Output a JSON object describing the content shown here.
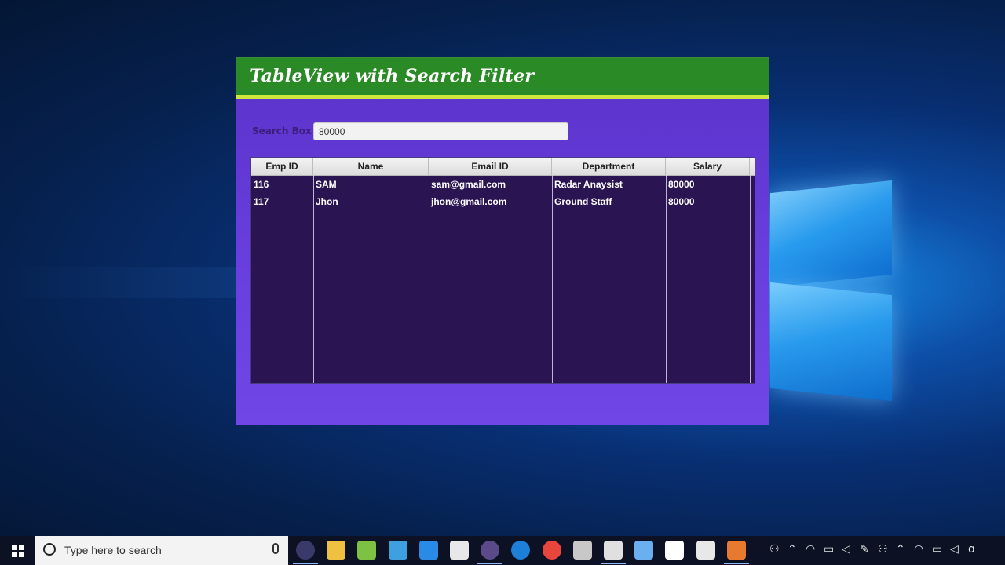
{
  "app": {
    "title": "TableView with Search Filter",
    "search_label": "Search Box",
    "search_value": "80000",
    "columns": [
      "Emp ID",
      "Name",
      "Email ID",
      "Department",
      "Salary"
    ],
    "rows": [
      {
        "emp_id": "116",
        "name": "SAM",
        "email": "sam@gmail.com",
        "department": "Radar Anaysist",
        "salary": "80000"
      },
      {
        "emp_id": "117",
        "name": "Jhon",
        "email": "jhon@gmail.com",
        "department": "Ground Staff",
        "salary": "80000"
      }
    ]
  },
  "taskbar": {
    "search_placeholder": "Type here to search",
    "icons": [
      {
        "name": "eclipse-icon",
        "color": "#3a3a6a"
      },
      {
        "name": "file-explorer-icon",
        "color": "#f0c040"
      },
      {
        "name": "notepad-plus-icon",
        "color": "#7dc242"
      },
      {
        "name": "network-icon",
        "color": "#3fa0e0"
      },
      {
        "name": "snipping-tool-icon",
        "color": "#2a8be6"
      },
      {
        "name": "paint-icon",
        "color": "#e8e8e8"
      },
      {
        "name": "eclipse-ide-icon",
        "color": "#5a4a8a"
      },
      {
        "name": "edge-icon",
        "color": "#1e7fd8"
      },
      {
        "name": "chrome-icon",
        "color": "#e8453c"
      },
      {
        "name": "paint-3d-icon",
        "color": "#c8c8c8"
      },
      {
        "name": "voice-recorder-icon",
        "color": "#e0e0e0"
      },
      {
        "name": "3d-viewer-icon",
        "color": "#6ab0f0"
      },
      {
        "name": "photos-icon",
        "color": "#ffffff"
      },
      {
        "name": "scene-builder-icon",
        "color": "#e8e8e8"
      },
      {
        "name": "java-icon",
        "color": "#e87a30"
      }
    ],
    "tray": [
      "people-icon",
      "chevron-up-icon",
      "wifi-icon",
      "battery-icon",
      "volume-icon",
      "pen-icon",
      "people-icon",
      "chevron-up-icon",
      "wifi-icon",
      "battery-icon",
      "volume-icon",
      "input-icon"
    ]
  }
}
